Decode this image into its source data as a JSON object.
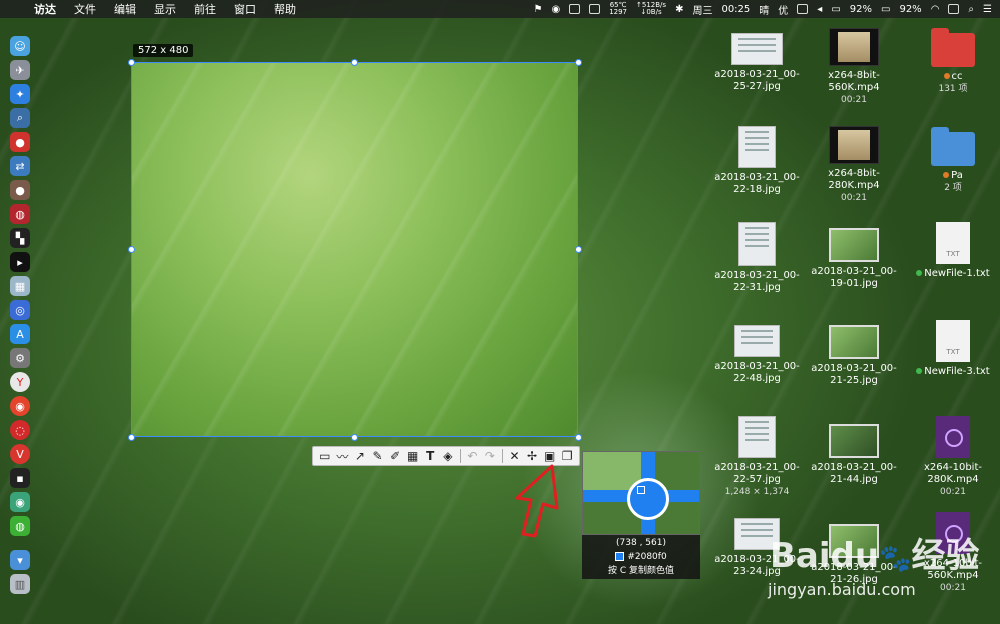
{
  "menubar": {
    "apple_glyph": "",
    "items": [
      "访达",
      "文件",
      "编辑",
      "显示",
      "前往",
      "窗口",
      "帮助"
    ],
    "temp": "65℃",
    "fan": "1297",
    "net_up": "↑512B/s",
    "net_down": "↓0B/s",
    "day": "周三",
    "time": "00:25",
    "weather": "晴",
    "air": "优",
    "battery_pct_1": "92%",
    "battery_pct_2": "92%"
  },
  "screenshot_tool": {
    "size_label": "572 x 480",
    "toolbar_icons": [
      "rectangle-icon",
      "curve-icon",
      "arrow-icon",
      "pen-icon",
      "highlighter-icon",
      "mosaic-icon",
      "text-icon",
      "eraser-icon",
      "undo-icon",
      "redo-icon",
      "close-icon",
      "pin-icon",
      "save-icon",
      "copy-icon"
    ],
    "text_tool_glyph": "T"
  },
  "magnifier": {
    "coords": "(738  ,  561)",
    "color_hex": "#2080f0",
    "hint": "按 C 复制颜色值"
  },
  "desktop_icons": [
    {
      "name": "a2018-03-21_00-25-27.jpg",
      "sub": ""
    },
    {
      "name": "x264-8bit-560K.mp4",
      "sub": "00:21"
    },
    {
      "name": "cc",
      "sub": "131 项"
    },
    {
      "name": "a2018-03-21_00-22-18.jpg",
      "sub": ""
    },
    {
      "name": "x264-8bit-280K.mp4",
      "sub": "00:21"
    },
    {
      "name": "Pa",
      "sub": "2 项"
    },
    {
      "name": "a2018-03-21_00-22-31.jpg",
      "sub": ""
    },
    {
      "name": "a2018-03-21_00-19-01.jpg",
      "sub": ""
    },
    {
      "name": "NewFile-1.txt",
      "sub": ""
    },
    {
      "name": "a2018-03-21_00-22-48.jpg",
      "sub": ""
    },
    {
      "name": "a2018-03-21_00-21-25.jpg",
      "sub": ""
    },
    {
      "name": "NewFile-3.txt",
      "sub": ""
    },
    {
      "name": "a2018-03-21_00-22-57.jpg",
      "sub": "1,248 × 1,374"
    },
    {
      "name": "a2018-03-21_00-21-44.jpg",
      "sub": ""
    },
    {
      "name": "x264-10bit-280K.mp4",
      "sub": "00:21"
    },
    {
      "name": "a2018-03-21_00-23-24.jpg",
      "sub": ""
    },
    {
      "name": "a2018-03-21_00-21-26.jpg",
      "sub": ""
    },
    {
      "name": "x264-10bit-560K.mp4",
      "sub": "00:21"
    }
  ],
  "file_type_labels": {
    "txt": "TXT"
  },
  "colors": {
    "selection": "#3d8bff",
    "picked": "#2080f0",
    "folder_red": "#d9403a",
    "folder_blue": "#4a90d9"
  },
  "watermark": {
    "brand": "Baidu",
    "brand_cn": "经验",
    "url": "jingyan.baidu.com"
  }
}
